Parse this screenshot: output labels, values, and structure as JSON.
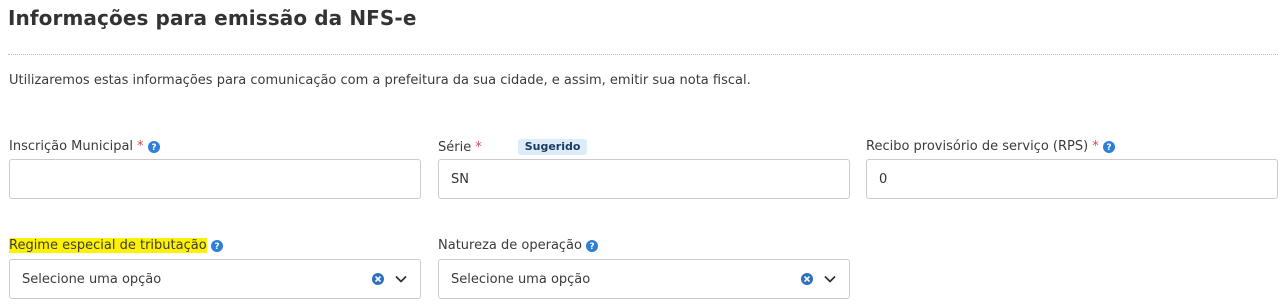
{
  "section": {
    "title": "Informações para emissão da NFS-e",
    "description": "Utilizaremos estas informações para comunicação com a prefeitura da sua cidade, e assim, emitir sua nota fiscal."
  },
  "fields": {
    "inscricao_municipal": {
      "label": "Inscrição Municipal",
      "required_mark": "*",
      "value": ""
    },
    "serie": {
      "label": "Série",
      "required_mark": "*",
      "badge": "Sugerido",
      "value": "SN"
    },
    "rps": {
      "label": "Recibo provisório de serviço (RPS)",
      "required_mark": "*",
      "value": "0"
    },
    "regime_especial": {
      "label": "Regime especial de tributação",
      "selected": "Selecione uma opção"
    },
    "natureza_operacao": {
      "label": "Natureza de operação",
      "selected": "Selecione uma opção"
    }
  },
  "icons": {
    "help": "help-circle-icon",
    "clear": "clear-x-icon",
    "chevron": "chevron-down-icon"
  },
  "colors": {
    "required": "#e0454a",
    "help_icon": "#2f7fd8",
    "badge_bg": "#dcecf9",
    "badge_text": "#1b3c62",
    "highlight": "#fff200"
  }
}
